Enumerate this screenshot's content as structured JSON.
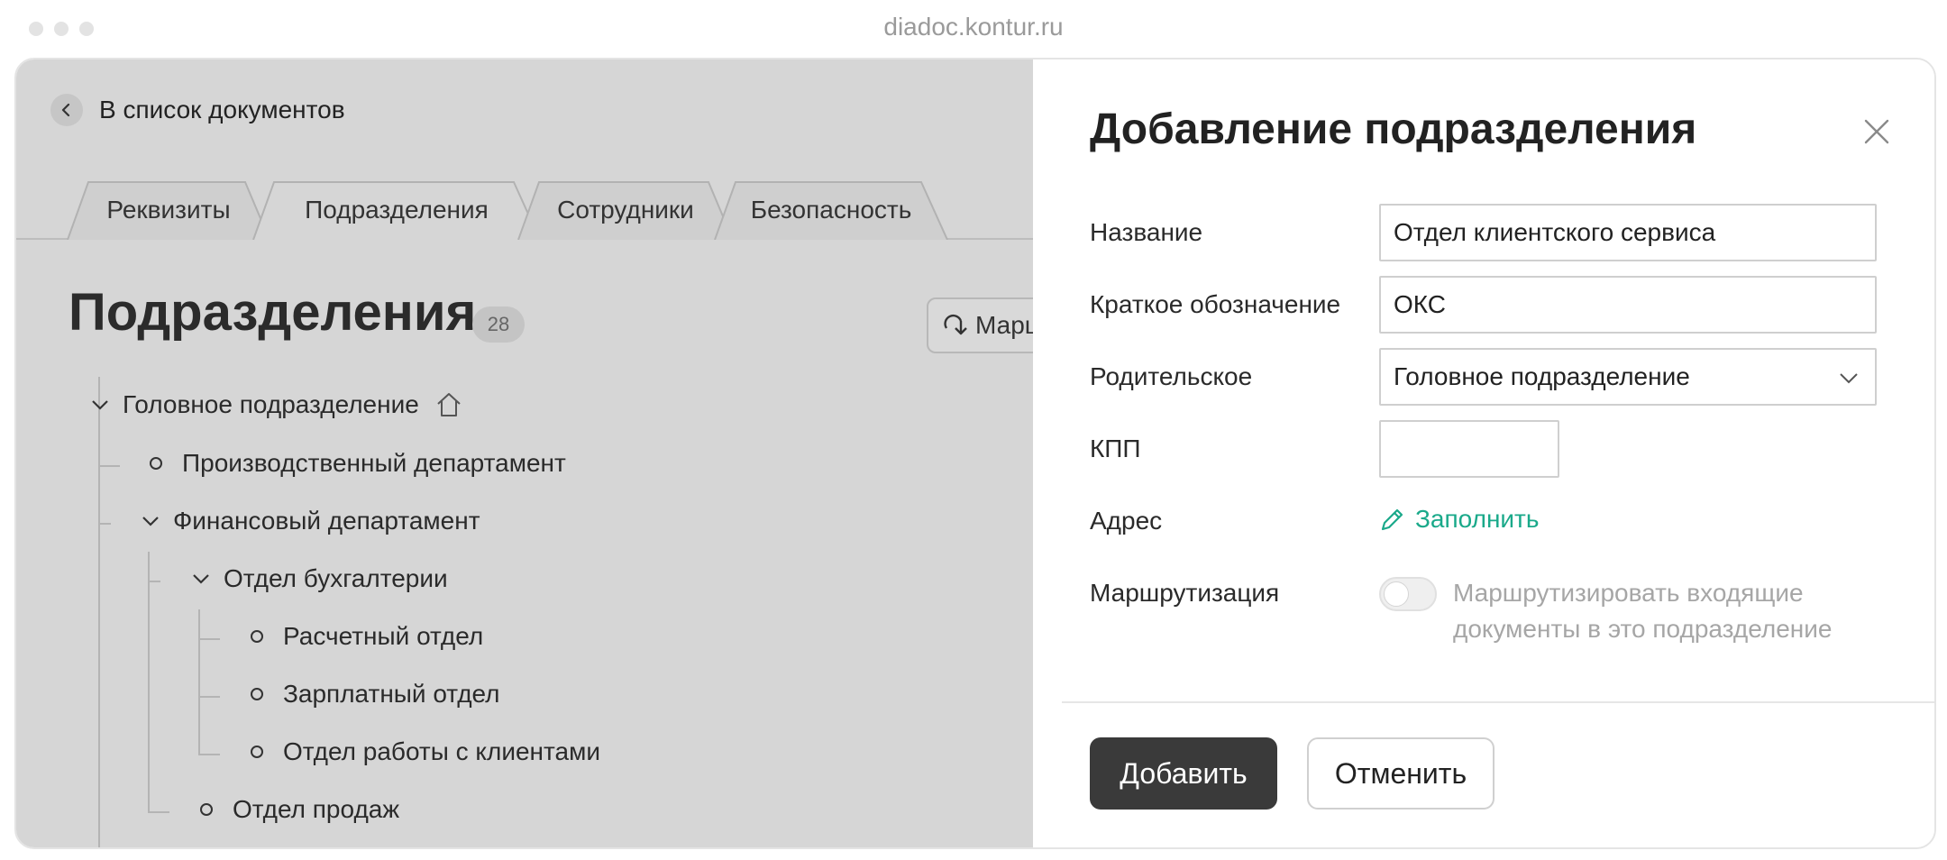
{
  "browser": {
    "url": "diadoc.kontur.ru"
  },
  "back_link": {
    "label": "В список документов"
  },
  "tabs": [
    {
      "label": "Реквизиты"
    },
    {
      "label": "Подразделения",
      "active": true
    },
    {
      "label": "Сотрудники"
    },
    {
      "label": "Безопасность"
    }
  ],
  "page": {
    "title": "Подразделения",
    "count": "28",
    "route_button_label": "Марш"
  },
  "tree": [
    {
      "label": "Головное подразделение",
      "expanded": true,
      "icon": "home-icon"
    },
    {
      "label": "Производственный департамент"
    },
    {
      "label": "Финансовый департамент",
      "expanded": true
    },
    {
      "label": "Отдел бухгалтерии",
      "expanded": true
    },
    {
      "label": "Расчетный отдел"
    },
    {
      "label": "Зарплатный отдел"
    },
    {
      "label": "Отдел работы с клиентами"
    },
    {
      "label": "Отдел продаж"
    }
  ],
  "dialog": {
    "title": "Добавление подразделения",
    "fields": {
      "name": {
        "label": "Название",
        "value": "Отдел клиентского сервиса"
      },
      "short": {
        "label": "Краткое обозначение",
        "value": "ОКС"
      },
      "parent": {
        "label": "Родительское",
        "value": "Головное подразделение"
      },
      "kpp": {
        "label": "КПП",
        "value": ""
      },
      "address": {
        "label": "Адрес",
        "link": "Заполнить"
      },
      "routing": {
        "label": "Маршрутизация",
        "toggle_text": "Маршрутизировать входящие документы в это подразделение",
        "enabled": false
      }
    },
    "buttons": {
      "primary": "Добавить",
      "secondary": "Отменить"
    }
  },
  "colors": {
    "accent": "#1aa98a",
    "primary_button": "#3a3a3a",
    "overlay": "#d6d6d6"
  }
}
